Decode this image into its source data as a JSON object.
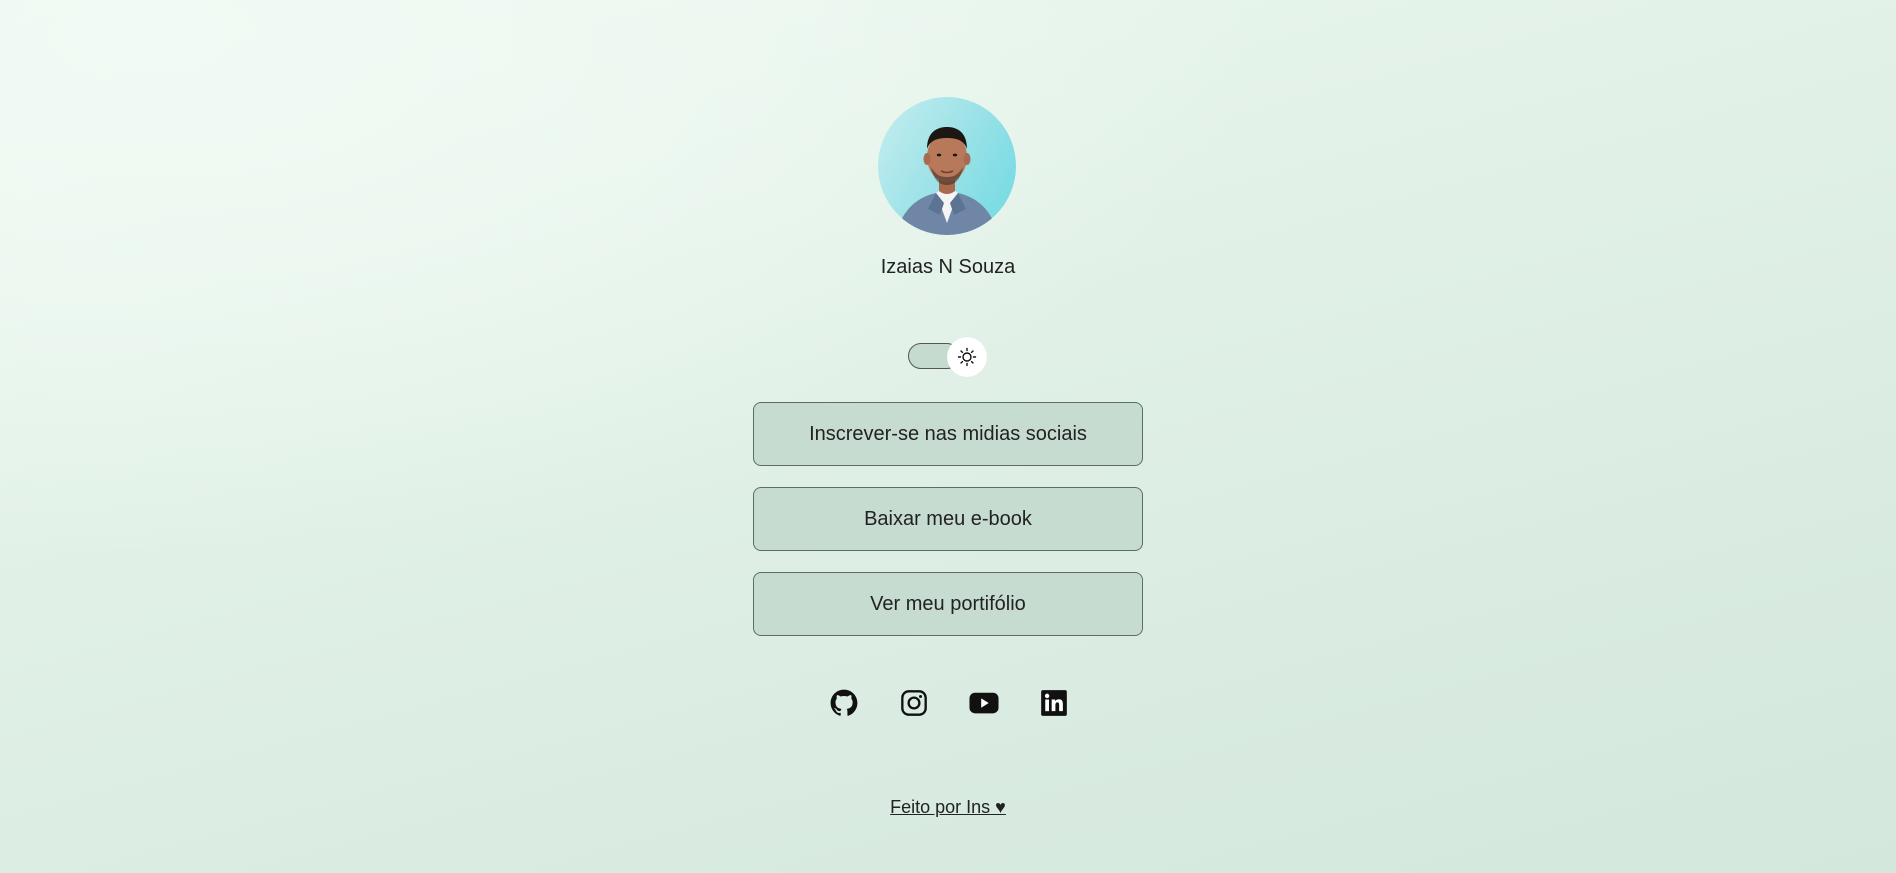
{
  "profile": {
    "name": "Izaias N Souza",
    "avatar_icon": "profile-photo",
    "avatar_bg": "#8fe0e6"
  },
  "theme_toggle": {
    "icon": "sun-icon"
  },
  "links": [
    {
      "label": "Inscrever-se nas midias sociais"
    },
    {
      "label": "Baixar meu e-book"
    },
    {
      "label": "Ver meu portifólio"
    }
  ],
  "socials": [
    {
      "icon": "github-icon"
    },
    {
      "icon": "instagram-icon"
    },
    {
      "icon": "youtube-icon"
    },
    {
      "icon": "linkedin-icon"
    }
  ],
  "footer": {
    "text": "Feito por Ins ♥"
  },
  "colors": {
    "button_bg": "#c7dcd1",
    "button_border": "#5c6d65",
    "page_bg": "#e0f0e6"
  }
}
